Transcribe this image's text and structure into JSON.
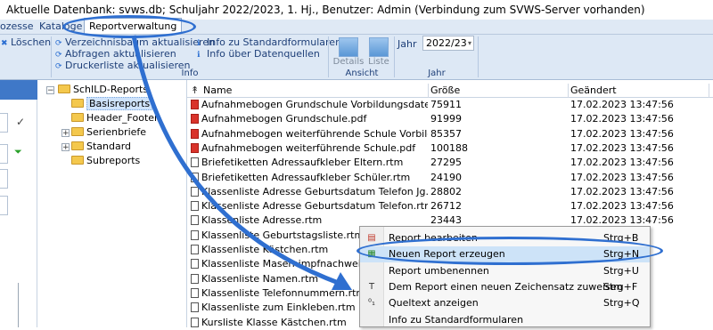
{
  "title": "Aktuelle Datenbank: svws.db; Schuljahr 2022/2023, 1. Hj., Benutzer: Admin (Verbindung zum SVWS-Server vorhanden)",
  "menu": {
    "items": [
      "ozesse",
      "Kataloge",
      "Reportverwaltung"
    ]
  },
  "ribbon": {
    "delete_label": "Löschen",
    "actions": [
      "Verzeichnisbaum aktualisieren",
      "Abfragen aktualisieren",
      "Druckerliste aktualisieren"
    ],
    "info_links": [
      "Info zu Standardformularen",
      "Info über Datenquellen"
    ],
    "info_group_label": "Info",
    "view_buttons": [
      "Details",
      "Liste"
    ],
    "view_group_label": "Ansicht",
    "year_label": "Jahr",
    "year_value": "2022/23",
    "year_group_label": "Jahr"
  },
  "tree": {
    "root": "SchILD-Reports",
    "children": [
      "Basisreports",
      "Header_Footer",
      "Serienbriefe",
      "Standard",
      "Subreports"
    ]
  },
  "grid": {
    "headers": [
      "Name",
      "Größe",
      "Geändert"
    ],
    "rows": [
      {
        "name": "Aufnahmebogen Grundschule Vorbildungsdaten.pdf",
        "type": "pdf",
        "size": "75911",
        "date": "17.02.2023 13:47:56"
      },
      {
        "name": "Aufnahmebogen Grundschule.pdf",
        "type": "pdf",
        "size": "91999",
        "date": "17.02.2023 13:47:56"
      },
      {
        "name": "Aufnahmebogen weiterführende Schule Vorbildungsd...",
        "type": "pdf",
        "size": "85357",
        "date": "17.02.2023 13:47:56"
      },
      {
        "name": "Aufnahmebogen weiterführende Schule.pdf",
        "type": "pdf",
        "size": "100188",
        "date": "17.02.2023 13:47:56"
      },
      {
        "name": "Briefetiketten Adressaufkleber Eltern.rtm",
        "type": "rtm",
        "size": "27295",
        "date": "17.02.2023 13:47:56"
      },
      {
        "name": "Briefetiketten Adressaufkleber Schüler.rtm",
        "type": "rtm",
        "size": "24190",
        "date": "17.02.2023 13:47:56"
      },
      {
        "name": "Klassenliste Adresse Geburtsdatum Telefon Jg.rtm",
        "type": "rtm",
        "size": "28802",
        "date": "17.02.2023 13:47:56"
      },
      {
        "name": "Klassenliste Adresse Geburtsdatum Telefon.rtm",
        "type": "rtm",
        "size": "26712",
        "date": "17.02.2023 13:47:56"
      },
      {
        "name": "Klassenliste Adresse.rtm",
        "type": "rtm",
        "size": "23443",
        "date": "17.02.2023 13:47:56"
      },
      {
        "name": "Klassenliste Geburtstagsliste.rtm",
        "type": "rtm",
        "size": "",
        "date": ""
      },
      {
        "name": "Klassenliste Kästchen.rtm",
        "type": "rtm",
        "size": "",
        "date": ""
      },
      {
        "name": "Klassenliste Masernimpfnachweis.rtm",
        "type": "rtm",
        "size": "",
        "date": ""
      },
      {
        "name": "Klassenliste Namen.rtm",
        "type": "rtm",
        "size": "",
        "date": ""
      },
      {
        "name": "Klassenliste Telefonnummern.rtm",
        "type": "rtm",
        "size": "",
        "date": ""
      },
      {
        "name": "Klassenliste zum Einkleben.rtm",
        "type": "rtm",
        "size": "",
        "date": ""
      },
      {
        "name": "Kursliste Klasse Kästchen.rtm",
        "type": "rtm",
        "size": "",
        "date": ""
      }
    ]
  },
  "context_menu": {
    "items": [
      {
        "label": "Report bearbeiten",
        "shortcut": "Strg+B",
        "icon": "edit-report-icon"
      },
      {
        "label": "Neuen Report erzeugen",
        "shortcut": "Strg+N",
        "icon": "new-report-icon"
      },
      {
        "label": "Report umbenennen",
        "shortcut": "Strg+U",
        "icon": ""
      },
      {
        "label": "Dem Report einen neuen Zeichensatz zuweisen",
        "shortcut": "Strg+F",
        "icon": "font-icon"
      },
      {
        "label": "Queltext anzeigen",
        "shortcut": "Strg+Q",
        "icon": "source-icon"
      },
      {
        "label": "Info zu Standardformularen",
        "shortcut": "",
        "icon": ""
      }
    ]
  },
  "colors": {
    "annotation": "#2f6fd0",
    "ribbon": "#dde8f5",
    "menu_highlight": "#cde3f8"
  }
}
